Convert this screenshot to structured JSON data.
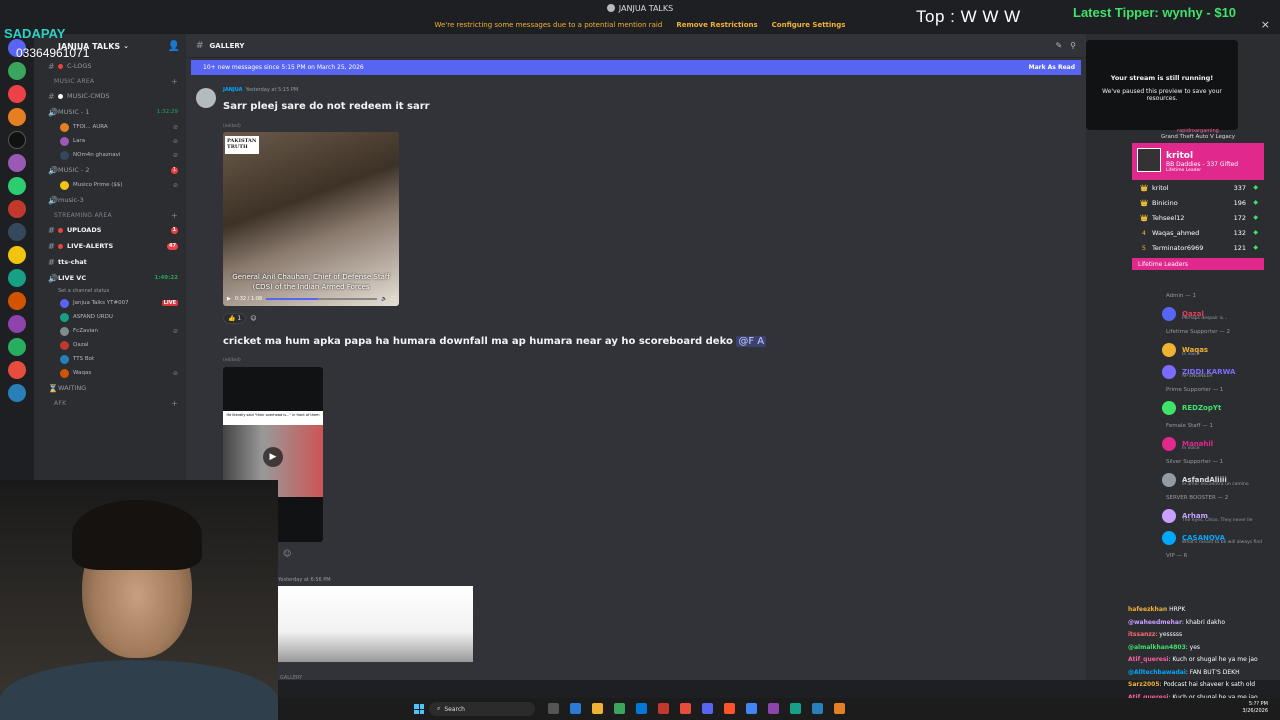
{
  "window": {
    "title": "JANJUA TALKS"
  },
  "notice": {
    "text": "We're restricting some messages due to a potential mention raid",
    "remove": "Remove Restrictions",
    "configure": "Configure Settings",
    "close": "×"
  },
  "server": {
    "name": "JANJUA TALKS"
  },
  "sidebar": {
    "channels": [
      {
        "name": "C-LOGS",
        "type": "text"
      },
      {
        "name": "MUSIC AREA",
        "type": "category"
      },
      {
        "name": "MUSIC-CMDS",
        "type": "text"
      },
      {
        "name": "MUSIC - 1",
        "type": "voice",
        "timer": "1:32:29"
      },
      {
        "name": "TFOI... AURA",
        "type": "user"
      },
      {
        "name": "Lara",
        "type": "user"
      },
      {
        "name": "NOm4n ghaznavi",
        "type": "user"
      },
      {
        "name": "MUSIC - 2",
        "type": "voice",
        "badge": "1"
      },
      {
        "name": "Musico Prime ($$)",
        "type": "user"
      },
      {
        "name": "music-3",
        "type": "voice"
      },
      {
        "name": "STREAMING AREA",
        "type": "category"
      },
      {
        "name": "UPLOADS",
        "type": "text",
        "badge": "1"
      },
      {
        "name": "LIVE-ALERTS",
        "type": "text",
        "badge": "47"
      },
      {
        "name": "tts-chat",
        "type": "text"
      },
      {
        "name": "LIVE VC",
        "type": "voice",
        "timer": "1:49:22"
      },
      {
        "name": "Set a channel status",
        "type": "status"
      },
      {
        "name": "Janjua Talks YT#007",
        "type": "user",
        "live": "LIVE"
      },
      {
        "name": "ASFAND URDU",
        "type": "user"
      },
      {
        "name": "FcZavian",
        "type": "user"
      },
      {
        "name": "Qazal",
        "type": "user"
      },
      {
        "name": "TTS Bot",
        "type": "user"
      },
      {
        "name": "Waqas",
        "type": "user"
      },
      {
        "name": "WAITING",
        "type": "voice"
      },
      {
        "name": "AFK",
        "type": "category"
      }
    ]
  },
  "channel": {
    "name": "GALLERY"
  },
  "newbar": {
    "text": "10+ new messages since 5:15 PM on March 25, 2026",
    "mark": "Mark As Read"
  },
  "messages": [
    {
      "author": "JANJUA",
      "time": "Yesterday at 5:15 PM",
      "text": "Sarr pleej sare do not redeem it sarr",
      "edited": "(edited)",
      "video": {
        "watermark": "PAKISTAN TRUTH",
        "caption": "General Anil Chauhan, Chief of Defense Staff (CDS) of the Indian Armed Forces",
        "time": "0:32 / 1:08",
        "progress": 0.47
      },
      "reaction": {
        "emoji": "👍",
        "count": "1"
      }
    },
    {
      "text": "cricket ma hum apka papa ha humara downfall ma ap humara near ay ho scoreboard deko",
      "mention": "@F A",
      "edited": "(edited)",
      "video_caption": "He literally said \"their overhead is...\" in front of them"
    },
    {
      "time": "Yesterday at 6:56 PM"
    }
  ],
  "composer": {
    "placeholder": "GALLERY"
  },
  "paused": {
    "title": "Your stream is still running!",
    "text": "We've paused this preview to save your resources."
  },
  "members": {
    "groups": [
      {
        "label": "Admin — 1",
        "members": [
          {
            "name": "Qazal",
            "color": "#e0405a",
            "sub": "Perhaps despair is..."
          }
        ]
      },
      {
        "label": "Lifetime Supporter — 2",
        "members": [
          {
            "name": "Waqas",
            "color": "#f0b232",
            "sub": "In voice"
          },
          {
            "name": "ZIDDI KARWA",
            "color": "#7b6cff",
            "sub": "AP ENGINEER"
          }
        ]
      },
      {
        "label": "Prime Supporter — 1",
        "members": [
          {
            "name": "REDZopYt",
            "color": "#3fe26b",
            "sub": ""
          }
        ]
      },
      {
        "label": "Female Staff — 1",
        "members": [
          {
            "name": "Manahil",
            "color": "#e0288d",
            "sub": "In voice"
          }
        ]
      },
      {
        "label": "Silver Supporter — 1",
        "members": [
          {
            "name": "AsfandAliiii",
            "color": "#dbdee1",
            "sub": "el amor encuentra un camino"
          }
        ]
      },
      {
        "label": "SERVER BOOSTER — 2",
        "members": [
          {
            "name": "Arham",
            "color": "#c9a0ff",
            "sub": "The eyes, Chico. They never lie"
          },
          {
            "name": "CASANOVA",
            "color": "#00a8fc",
            "sub": "What's meant to be will always find"
          }
        ]
      },
      {
        "label": "VIP — 6",
        "members": []
      }
    ]
  },
  "overlay": {
    "top": "Top : W W W",
    "tipper": "Latest Tipper: wynhy - $10",
    "sadapay": "SADAPAY",
    "phone": "03364961071",
    "leaderboard": {
      "gamer": "rapidroargaming",
      "game": "Grand Theft Auto V Legacy",
      "top": {
        "name": "kritol",
        "sub": "BB Daddies - 337 Gifted",
        "label": "Lifetime Leader"
      },
      "rows": [
        {
          "rank": "👑",
          "name": "kritol",
          "value": "337"
        },
        {
          "rank": "👑",
          "name": "Binicino",
          "value": "196"
        },
        {
          "rank": "👑",
          "name": "Tehseel12",
          "value": "172"
        },
        {
          "rank": "4",
          "name": "Waqas_ahmed",
          "value": "132"
        },
        {
          "rank": "5",
          "name": "Terminator6969",
          "value": "121"
        }
      ],
      "footer": "Lifetime Leaders"
    },
    "chat": [
      {
        "user": "hafeezkhan",
        "text": "HRPK",
        "color": "#f0b232"
      },
      {
        "user": "@waheedmehar",
        "text": ": khabri dakho",
        "color": "#c9a0ff"
      },
      {
        "user": "itssanzz",
        "text": ": yesssss",
        "color": "#ff6b6b"
      },
      {
        "user": "@almalkhan4803",
        "text": ": yes",
        "color": "#3fe26b"
      },
      {
        "user": "Atif_queresi",
        "text": ": Kuch or shugal he ya me jao",
        "color": "#ff5fa2"
      },
      {
        "user": "@Alltechbawadai",
        "text": ": FAN BUT'S DEKH",
        "color": "#00a8fc"
      },
      {
        "user": "Sarz2005",
        "text": ": Podcast hai shaveer k sath old",
        "color": "#f0b232"
      },
      {
        "user": "Atif_queresi",
        "text": ": Kuch or shugal he ya me jao",
        "color": "#ff5fa2"
      }
    ]
  },
  "taskbar": {
    "search": "Search",
    "time": "5:?? PM",
    "date": "3/26/2026"
  }
}
